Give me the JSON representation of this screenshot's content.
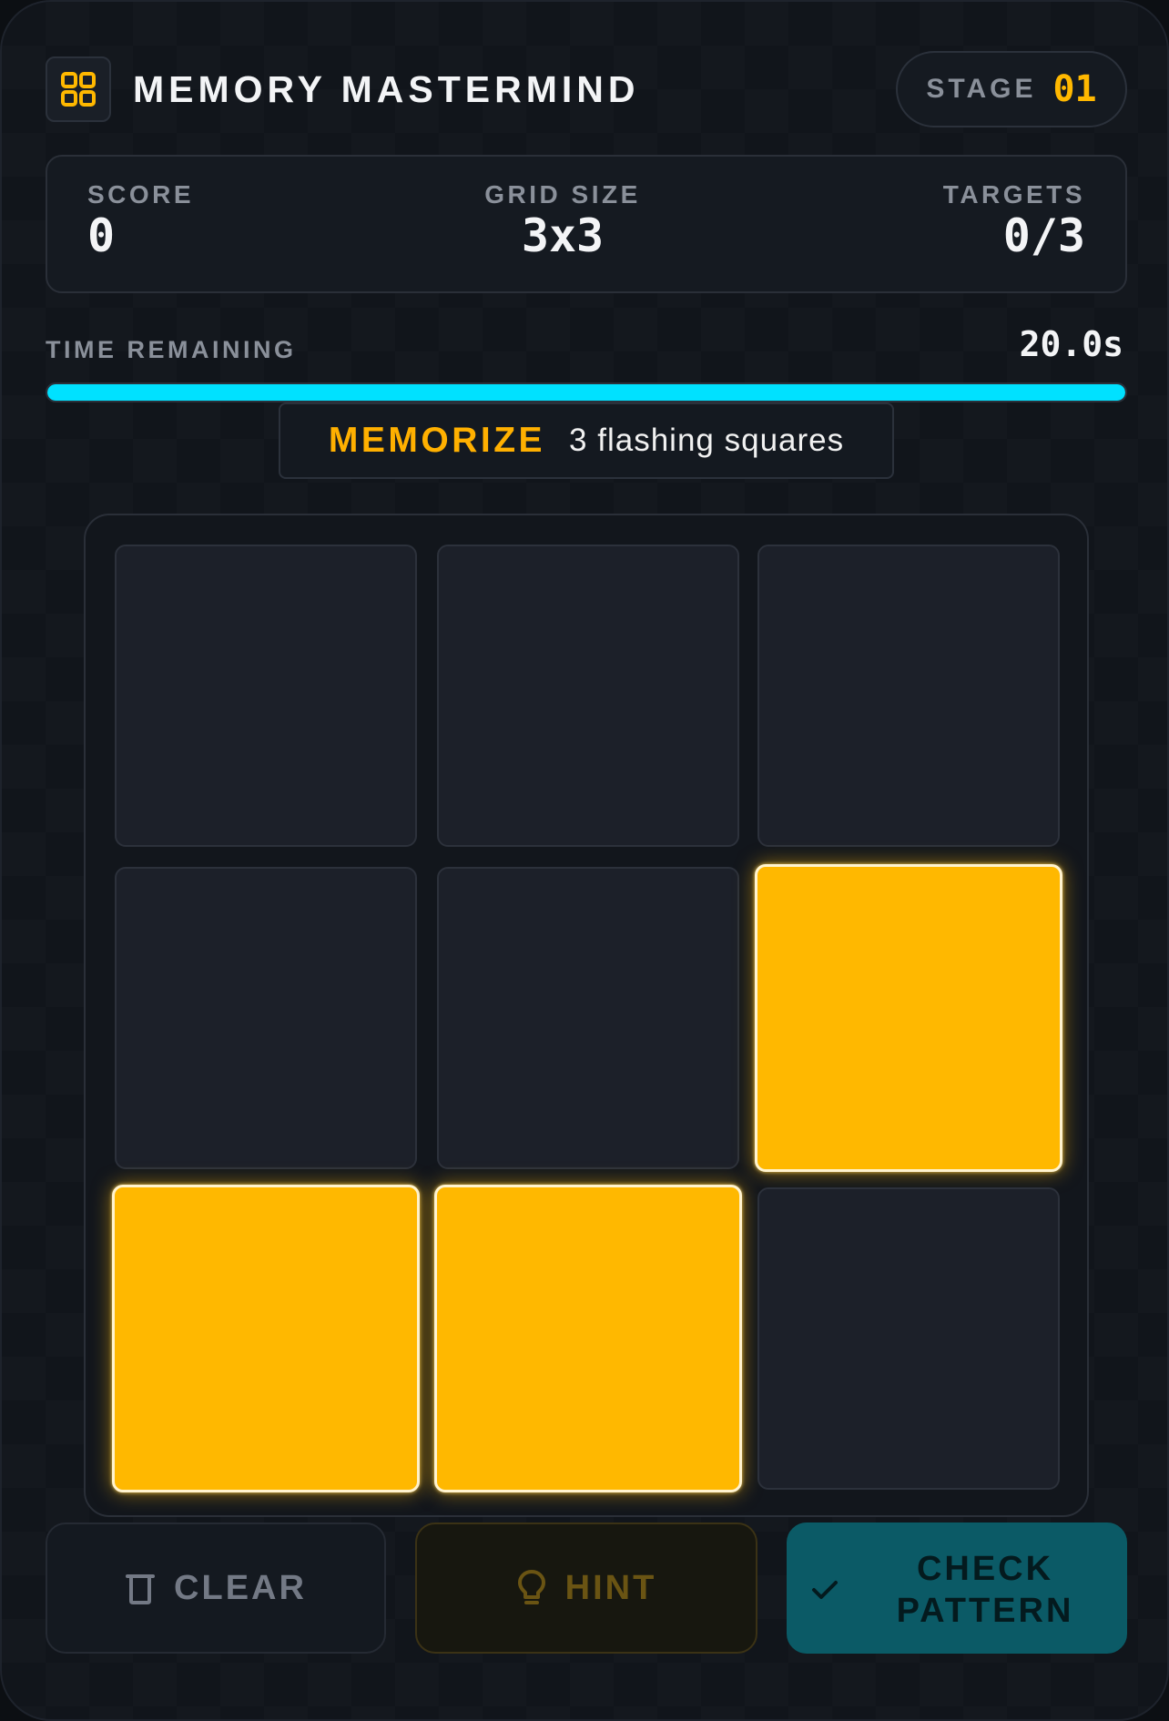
{
  "header": {
    "title": "MEMORY MASTERMIND",
    "stage_label": "STAGE",
    "stage_number": "01"
  },
  "stats": {
    "score_label": "SCORE",
    "score_value": "0",
    "grid_label": "GRID SIZE",
    "grid_value": "3x3",
    "targets_label": "TARGETS",
    "targets_value": "0/3"
  },
  "timer": {
    "label": "TIME REMAINING",
    "value": "20.0s",
    "fill_fraction": 1.0
  },
  "instruction": {
    "phase": "MEMORIZE",
    "detail": "3 flashing squares"
  },
  "grid": {
    "rows": 3,
    "cols": 3,
    "cells": [
      {
        "row": 0,
        "col": 0,
        "lit": false
      },
      {
        "row": 0,
        "col": 1,
        "lit": false
      },
      {
        "row": 0,
        "col": 2,
        "lit": false
      },
      {
        "row": 1,
        "col": 0,
        "lit": false
      },
      {
        "row": 1,
        "col": 1,
        "lit": false
      },
      {
        "row": 1,
        "col": 2,
        "lit": true
      },
      {
        "row": 2,
        "col": 0,
        "lit": true
      },
      {
        "row": 2,
        "col": 1,
        "lit": true
      },
      {
        "row": 2,
        "col": 2,
        "lit": false
      }
    ]
  },
  "buttons": {
    "clear_label": "CLEAR",
    "hint_label": "HINT",
    "check_label": "CHECK PATTERN"
  },
  "icons": {
    "logo": "grid-icon",
    "clear": "trash-icon",
    "hint": "lightbulb-icon",
    "check": "checkmark-icon"
  },
  "colors": {
    "accent": "#ffb800",
    "timer": "#00e1ff",
    "check_button": "#0b5a66",
    "cell_empty": "#1c2029"
  }
}
